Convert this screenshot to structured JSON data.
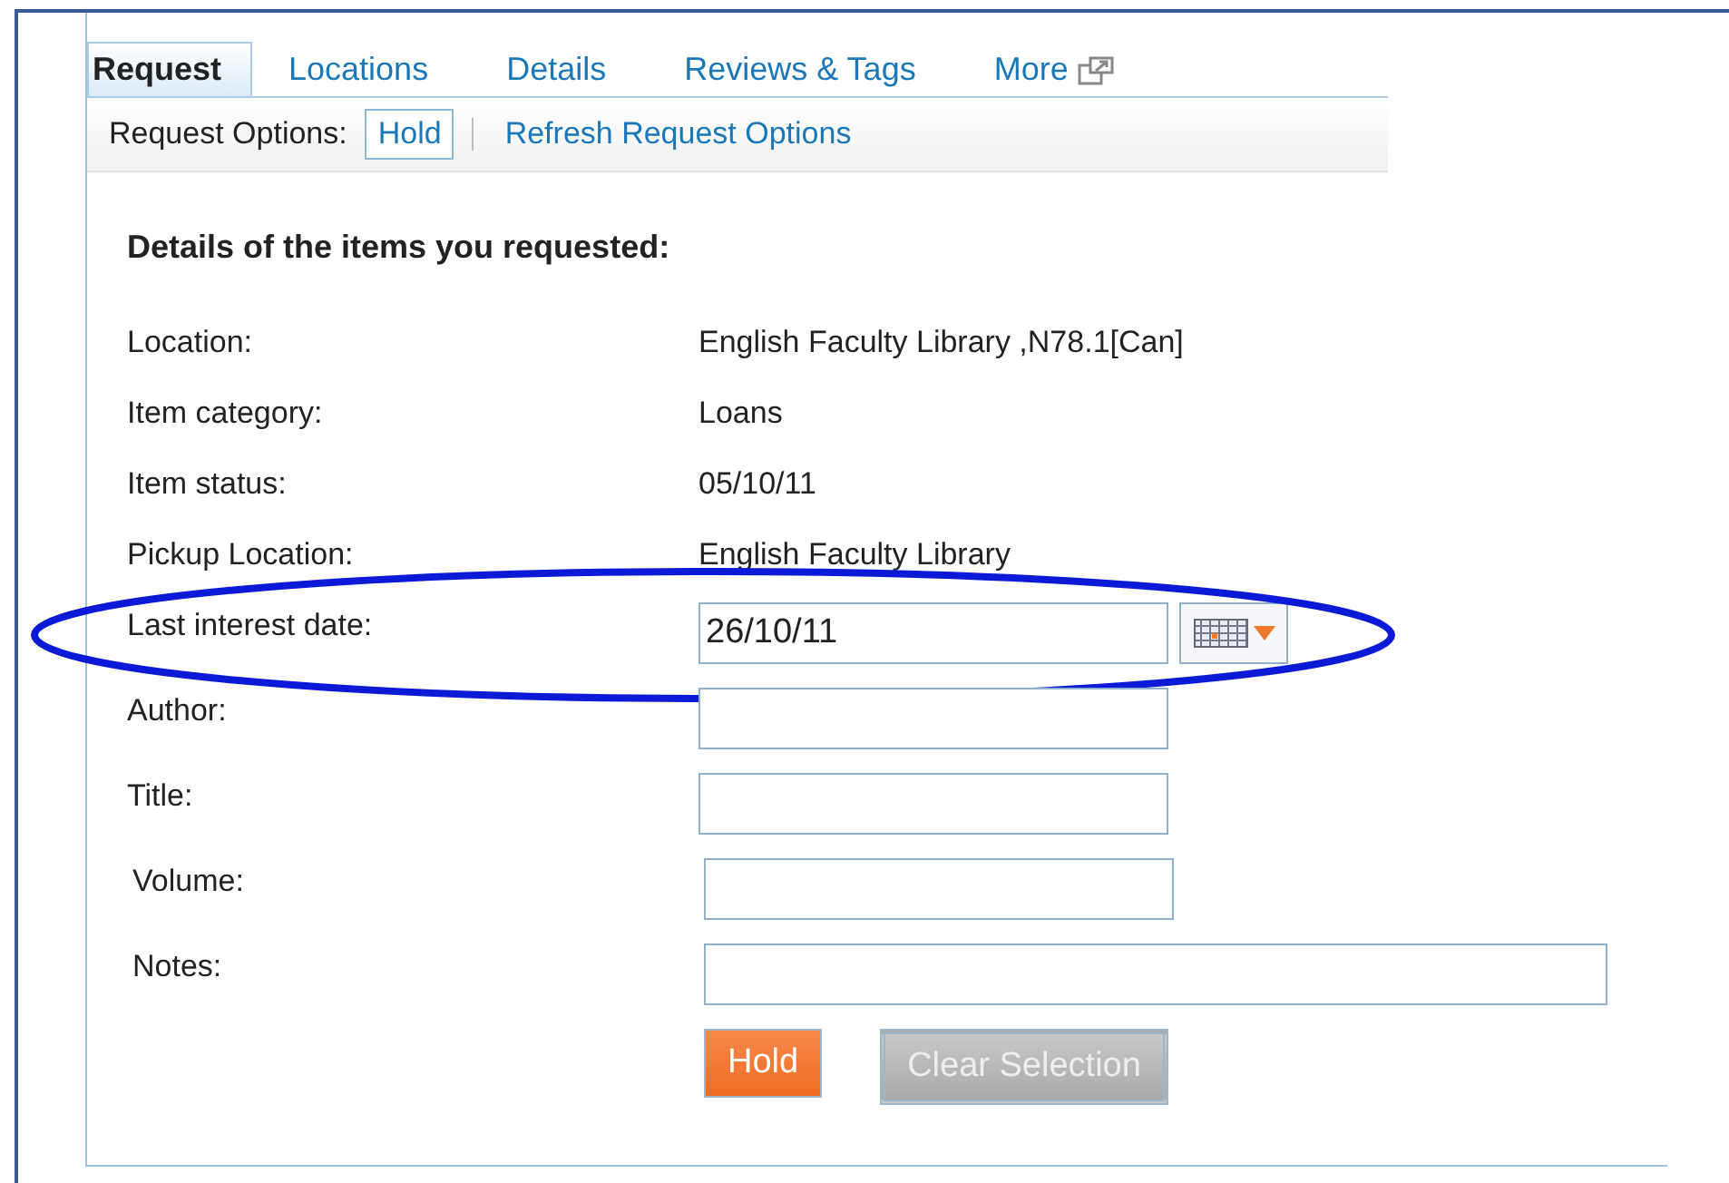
{
  "tabs": [
    {
      "label": "Request",
      "selected": true
    },
    {
      "label": "Locations",
      "selected": false
    },
    {
      "label": "Details",
      "selected": false
    },
    {
      "label": "Reviews & Tags",
      "selected": false
    },
    {
      "label": "More",
      "selected": false,
      "external": true
    }
  ],
  "request_options": {
    "label": "Request Options:",
    "options": [
      {
        "label": "Hold",
        "selected": true
      },
      {
        "label": "Refresh Request Options",
        "selected": false
      }
    ]
  },
  "heading": "Details of the items you requested:",
  "details": [
    {
      "label": "Location:",
      "value": "English Faculty Library ,N78.1[Can]"
    },
    {
      "label": "Item category:",
      "value": "Loans"
    },
    {
      "label": "Item status:",
      "value": "05/10/11"
    },
    {
      "label": "Pickup Location:",
      "value": "English Faculty Library"
    }
  ],
  "fields": [
    {
      "kind": "date",
      "label": "Last interest date:",
      "value": "26/10/11",
      "highlighted": true
    },
    {
      "kind": "text",
      "label": "Author:"
    },
    {
      "kind": "text",
      "label": "Title:"
    },
    {
      "kind": "text",
      "label": "Volume:"
    },
    {
      "kind": "wide",
      "label": "Notes:"
    }
  ],
  "buttons": [
    {
      "label": "Hold",
      "kind": "primary",
      "disabled": false
    },
    {
      "label": "Clear Selection",
      "kind": "secondary",
      "disabled": true
    }
  ]
}
